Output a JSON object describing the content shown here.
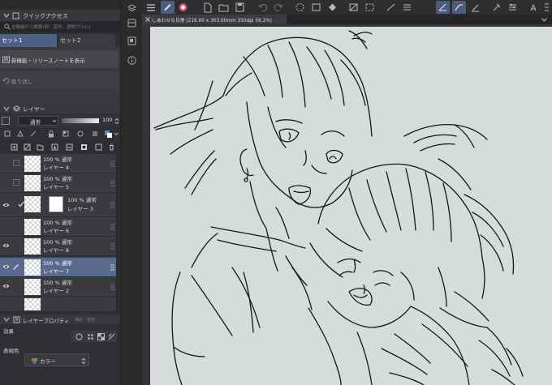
{
  "quick_access": {
    "title": "クイックアクセス",
    "search_placeholder": "全機能から検索(例：変形、透明プラシ)",
    "tabs": [
      "セット1",
      "セット2"
    ],
    "buttons": [
      "新機能・リリースノートを表示",
      "取り消し"
    ]
  },
  "layer_panel": {
    "title": "レイヤー",
    "blend_mode": "通常",
    "opacity": "100",
    "layers": [
      {
        "opacity_mode": "100 % 通常",
        "name": "レイヤー 4",
        "selected": false,
        "visible": false
      },
      {
        "opacity_mode": "100 % 通常",
        "name": "レイヤー 5",
        "selected": false,
        "visible": false
      },
      {
        "opacity_mode": "100 % 通常",
        "name": "レイヤー 3",
        "selected": false,
        "visible": true
      },
      {
        "opacity_mode": "100 % 通常",
        "name": "レイヤー 6",
        "selected": false,
        "visible": false
      },
      {
        "opacity_mode": "100 % 通常",
        "name": "レイヤー 8",
        "selected": false,
        "visible": true
      },
      {
        "opacity_mode": "100 % 通常",
        "name": "レイヤー 7",
        "selected": true,
        "visible": true
      },
      {
        "opacity_mode": "100 % 通常",
        "name": "レイヤー 2",
        "selected": false,
        "visible": true
      }
    ]
  },
  "properties": {
    "title": "レイヤープロパティ",
    "sub": "補助・排他",
    "effect_label": "効果",
    "color_label": "表現色",
    "color_value": "カラー"
  },
  "document": {
    "tab_title": "しあわせな日常 (216.00 x 303.00mm 350dpi 56.2%)"
  },
  "colors": {
    "accent": "#5a6a8e",
    "canvas": "#d6dbdc",
    "panel": "#2f2f33"
  }
}
